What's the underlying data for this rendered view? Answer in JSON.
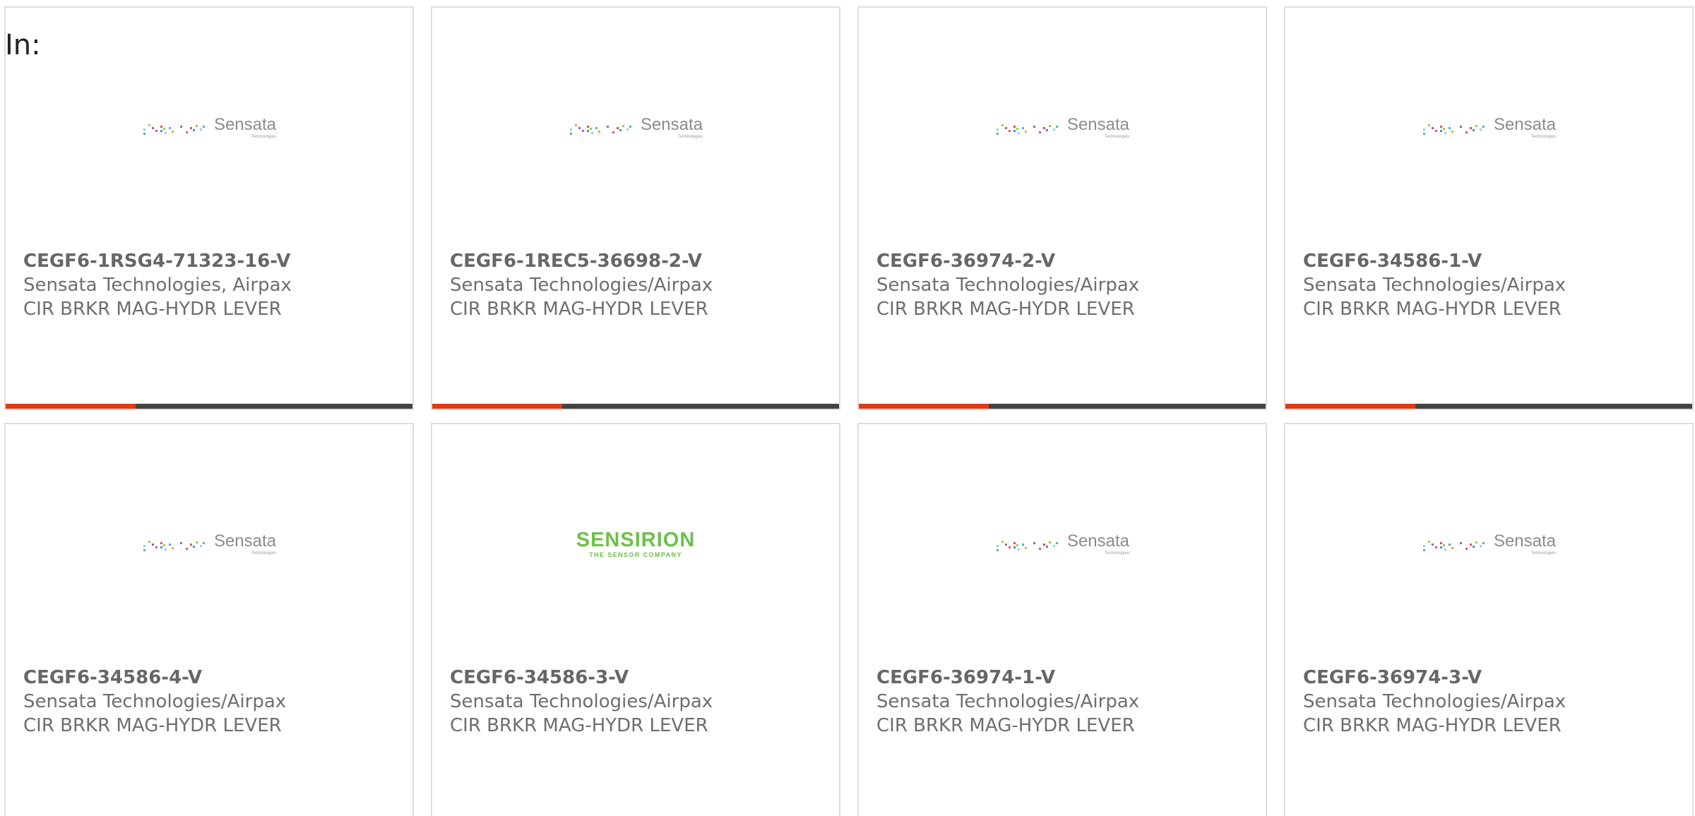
{
  "header": {
    "label": "In:"
  },
  "colors": {
    "accent": "#e23a12",
    "bar_track": "#444444",
    "card_border": "#dedede",
    "sensirion_green": "#6cc04a"
  },
  "cards": [
    {
      "part": "CEGF6-1RSG4-71323-16-V",
      "maker": "Sensata Technologies, Airpax",
      "desc": "CIR BRKR MAG-HYDR LEVER",
      "logo_type": "sensata",
      "logo_name": "Sensata",
      "logo_sub": "Technologies",
      "progress": 0.32,
      "show_bar": true
    },
    {
      "part": "CEGF6-1REC5-36698-2-V",
      "maker": "Sensata Technologies/Airpax",
      "desc": "CIR BRKR MAG-HYDR LEVER",
      "logo_type": "sensata",
      "logo_name": "Sensata",
      "logo_sub": "Technologies",
      "progress": 0.32,
      "show_bar": true
    },
    {
      "part": "CEGF6-36974-2-V",
      "maker": "Sensata Technologies/Airpax",
      "desc": "CIR BRKR MAG-HYDR LEVER",
      "logo_type": "sensata",
      "logo_name": "Sensata",
      "logo_sub": "Technologies",
      "progress": 0.32,
      "show_bar": true
    },
    {
      "part": "CEGF6-34586-1-V",
      "maker": "Sensata Technologies/Airpax",
      "desc": "CIR BRKR MAG-HYDR LEVER",
      "logo_type": "sensata",
      "logo_name": "Sensata",
      "logo_sub": "Technologies",
      "progress": 0.32,
      "show_bar": true
    },
    {
      "part": "CEGF6-34586-4-V",
      "maker": "Sensata Technologies/Airpax",
      "desc": "CIR BRKR MAG-HYDR LEVER",
      "logo_type": "sensata",
      "logo_name": "Sensata",
      "logo_sub": "Technologies",
      "show_bar": false
    },
    {
      "part": "CEGF6-34586-3-V",
      "maker": "Sensata Technologies/Airpax",
      "desc": "CIR BRKR MAG-HYDR LEVER",
      "logo_type": "sensirion",
      "logo_name": "SENSIRION",
      "logo_sub": "THE SENSOR COMPANY",
      "show_bar": false
    },
    {
      "part": "CEGF6-36974-1-V",
      "maker": "Sensata Technologies/Airpax",
      "desc": "CIR BRKR MAG-HYDR LEVER",
      "logo_type": "sensata",
      "logo_name": "Sensata",
      "logo_sub": "Technologies",
      "show_bar": false
    },
    {
      "part": "CEGF6-36974-3-V",
      "maker": "Sensata Technologies/Airpax",
      "desc": "CIR BRKR MAG-HYDR LEVER",
      "logo_type": "sensata",
      "logo_name": "Sensata",
      "logo_sub": "Technologies",
      "show_bar": false
    }
  ]
}
